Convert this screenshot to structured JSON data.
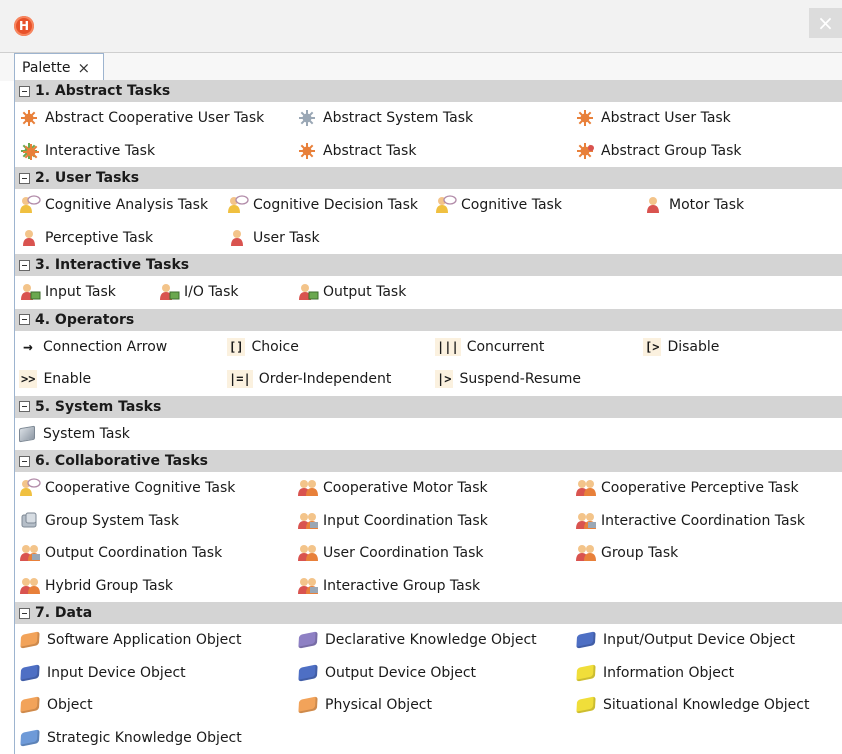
{
  "window": {
    "logo_letter": "H",
    "close_glyph": "×"
  },
  "tab": {
    "label": "Palette",
    "close_glyph": "×"
  },
  "colors": {
    "section_bg": "#d4d4d4",
    "person_red": "#d9534f",
    "burst_orange": "#e8803a",
    "gem_orange": "#f2a35a",
    "gem_purple": "#8e80c4",
    "gem_blue": "#4e6fc4",
    "gem_yellow": "#f0de3a"
  },
  "sections": [
    {
      "title": "1. Abstract Tasks",
      "rows": [
        [
          {
            "col": 0,
            "label": "Abstract Cooperative User Task",
            "icon": "abstract-cooperative-user-task-icon"
          },
          {
            "col": 1,
            "label": "Abstract System Task",
            "icon": "abstract-system-task-icon"
          },
          {
            "col": 3,
            "label": "Abstract User Task",
            "icon": "abstract-user-task-icon"
          }
        ],
        [
          {
            "col": 0,
            "label": "Interactive Task",
            "icon": "interactive-task-icon"
          },
          {
            "col": 1,
            "label": "Abstract Task",
            "icon": "abstract-task-icon"
          },
          {
            "col": 3,
            "label": "Abstract Group Task",
            "icon": "abstract-group-task-icon"
          }
        ]
      ]
    },
    {
      "title": "2. User Tasks",
      "rows": [
        [
          {
            "col": 0,
            "label": "Cognitive Analysis Task",
            "icon": "cognitive-analysis-task-icon"
          },
          {
            "col": "1b",
            "label": "Cognitive Decision Task",
            "icon": "cognitive-decision-task-icon"
          },
          {
            "col": "2b",
            "label": "Cognitive Task",
            "icon": "cognitive-task-icon"
          },
          {
            "col": "3b",
            "label": "Motor Task",
            "icon": "motor-task-icon"
          }
        ],
        [
          {
            "col": 0,
            "label": "Perceptive Task",
            "icon": "perceptive-task-icon"
          },
          {
            "col": "1b",
            "label": "User Task",
            "icon": "user-task-icon"
          }
        ]
      ]
    },
    {
      "title": "3. Interactive Tasks",
      "rows": [
        [
          {
            "col": 0,
            "label": "Input Task",
            "icon": "input-task-icon"
          },
          {
            "col": "io",
            "label": "I/O Task",
            "icon": "io-task-icon"
          },
          {
            "col": 1,
            "label": "Output Task",
            "icon": "output-task-icon"
          }
        ]
      ]
    },
    {
      "title": "4. Operators",
      "rows": [
        [
          {
            "col": 0,
            "label": "Connection Arrow",
            "op": "→"
          },
          {
            "col": "1b",
            "label": "Choice",
            "op": "[]"
          },
          {
            "col": "2b",
            "label": "Concurrent",
            "op": "|||"
          },
          {
            "col": "3b",
            "label": "Disable",
            "op": "[>"
          }
        ],
        [
          {
            "col": 0,
            "label": "Enable",
            "op": ">>"
          },
          {
            "col": "1b",
            "label": "Order-Independent",
            "op": "|=|"
          },
          {
            "col": "2b",
            "label": "Suspend-Resume",
            "op": "|>"
          }
        ]
      ]
    },
    {
      "title": "5. System Tasks",
      "rows": [
        [
          {
            "col": 0,
            "label": "System Task",
            "icon": "system-task-icon"
          }
        ]
      ]
    },
    {
      "title": "6. Collaborative Tasks",
      "rows": [
        [
          {
            "col": 0,
            "label": "Cooperative Cognitive Task",
            "icon": "cooperative-cognitive-task-icon"
          },
          {
            "col": 1,
            "label": "Cooperative Motor Task",
            "icon": "cooperative-motor-task-icon"
          },
          {
            "col": 3,
            "label": "Cooperative Perceptive Task",
            "icon": "cooperative-perceptive-task-icon"
          }
        ],
        [
          {
            "col": 0,
            "label": "Group System Task",
            "icon": "group-system-task-icon"
          },
          {
            "col": 1,
            "label": "Input Coordination Task",
            "icon": "input-coordination-task-icon"
          },
          {
            "col": 3,
            "label": "Interactive Coordination Task",
            "icon": "interactive-coordination-task-icon"
          }
        ],
        [
          {
            "col": 0,
            "label": "Output Coordination Task",
            "icon": "output-coordination-task-icon"
          },
          {
            "col": 1,
            "label": "User Coordination Task",
            "icon": "user-coordination-task-icon"
          },
          {
            "col": 3,
            "label": "Group Task",
            "icon": "group-task-icon"
          }
        ],
        [
          {
            "col": 0,
            "label": "Hybrid Group Task",
            "icon": "hybrid-group-task-icon"
          },
          {
            "col": 1,
            "label": "Interactive Group Task",
            "icon": "interactive-group-task-icon"
          }
        ]
      ]
    },
    {
      "title": "7. Data",
      "rows": [
        [
          {
            "col": 0,
            "label": "Software Application Object",
            "gem": "#f2a35a"
          },
          {
            "col": 1,
            "label": "Declarative Knowledge Object",
            "gem": "#8e80c4"
          },
          {
            "col": 3,
            "label": "Input/Output Device Object",
            "gem": "#4e6fc4"
          }
        ],
        [
          {
            "col": 0,
            "label": "Input Device Object",
            "gem": "#4e6fc4"
          },
          {
            "col": 1,
            "label": "Output Device Object",
            "gem": "#4e6fc4"
          },
          {
            "col": 3,
            "label": "Information Object",
            "gem": "#f0de3a"
          }
        ],
        [
          {
            "col": 0,
            "label": "Object",
            "gem": "#f2a35a"
          },
          {
            "col": 1,
            "label": "Physical Object",
            "gem": "#f2a35a"
          },
          {
            "col": 3,
            "label": "Situational Knowledge Object",
            "gem": "#f0de3a"
          }
        ],
        [
          {
            "col": 0,
            "label": "Strategic Knowledge Object",
            "gem": "#6e9ad8"
          }
        ]
      ]
    }
  ]
}
